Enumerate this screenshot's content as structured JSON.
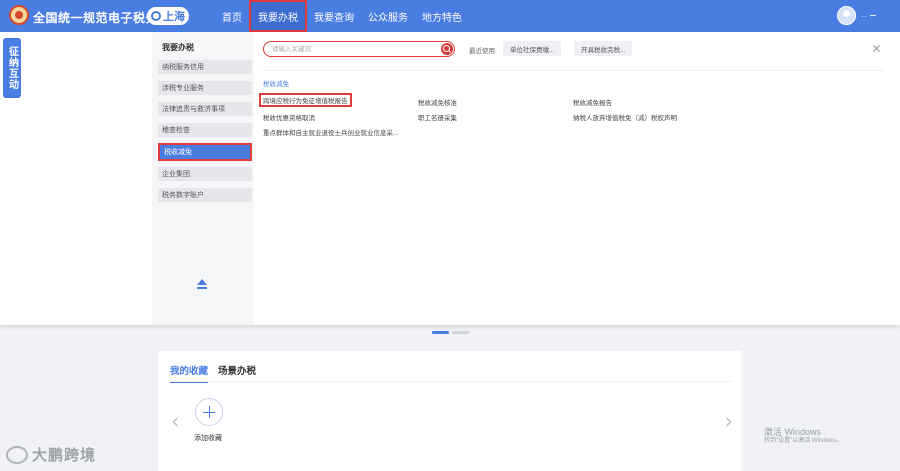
{
  "header": {
    "site_title": "全国统一规范电子税务局",
    "region": "上海",
    "nav": [
      "首页",
      "我要办税",
      "我要查询",
      "公众服务",
      "地方特色"
    ],
    "user_name": "··"
  },
  "float_tab": "征纳互动",
  "menu": {
    "title": "我要办税",
    "items": [
      "纳税服务信用",
      "涉税专业服务",
      "法律追责与救济事项",
      "稽查检查",
      "税收减免",
      "企业集团",
      "税务数字账户"
    ],
    "active_index": 4
  },
  "search": {
    "placeholder": "请输入关键词"
  },
  "recent": {
    "label": "最近使用:",
    "chips": [
      "单位社保费缴...",
      "开具税收完税..."
    ]
  },
  "section": {
    "title": "税收减免",
    "links": [
      "跨境应税行为免征增值税报告",
      "税收减免核准",
      "税收减免报告",
      "税收优惠资格取消",
      "职工名册采集",
      "纳税人放弃增值税免（减）税权声明",
      "重点群体和自主就业退役士兵创业就业信息采..."
    ]
  },
  "favorites": {
    "tabs": [
      "我的收藏",
      "场景办税"
    ],
    "add_label": "添加收藏"
  },
  "watermark": {
    "title": "激活 Windows",
    "subtitle": "转到\"设置\"以激活 Windows。"
  },
  "brand": "大鹏跨境"
}
